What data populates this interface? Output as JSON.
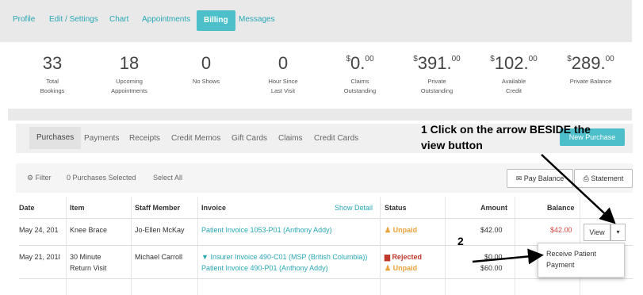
{
  "top_tabs": [
    "Profile",
    "Edit / Settings",
    "Chart",
    "Appointments",
    "Billing",
    "Messages"
  ],
  "active_tab": "Billing",
  "stats": [
    {
      "value": "33",
      "cents": "",
      "label_lines": [
        "Total",
        "Bookings"
      ]
    },
    {
      "value": "18",
      "cents": "",
      "label_lines": [
        "Upcoming",
        "Appointments"
      ]
    },
    {
      "value": "0",
      "cents": "",
      "label_lines": [
        "No Shows",
        ""
      ]
    },
    {
      "value": "0",
      "cents": "",
      "label_lines": [
        "Hour Since",
        "Last Visit"
      ]
    },
    {
      "currency": "$",
      "value": "0.",
      "cents": "00",
      "label_lines": [
        "Claims",
        "Outstanding"
      ]
    },
    {
      "currency": "$",
      "value": "391.",
      "cents": "00",
      "label_lines": [
        "Private",
        "Outstanding"
      ]
    },
    {
      "currency": "$",
      "value": "102.",
      "cents": "00",
      "label_lines": [
        "Available",
        "Credit"
      ]
    },
    {
      "currency": "$",
      "value": "289.",
      "cents": "00",
      "label_lines": [
        "Private Balance",
        ""
      ]
    }
  ],
  "sub_tabs": [
    "Purchases",
    "Payments",
    "Receipts",
    "Credit Memos",
    "Gift Cards",
    "Claims",
    "Credit Cards"
  ],
  "active_sub_tab": "Purchases",
  "new_purchase_label": "New Purchase",
  "filter_label": "Filter",
  "selected_count_label": "0 Purchases Selected",
  "select_all_label": "Select All",
  "pay_balance_label": "Pay Balance",
  "statement_label": "Statement",
  "table": {
    "headers": [
      "Date",
      "Item",
      "Staff Member",
      "Invoice",
      "Show Detail",
      "Status",
      "Amount",
      "Balance"
    ],
    "rows": [
      {
        "date": "May 24, 201",
        "item": [
          "Knee Brace"
        ],
        "staff": "Jo-Ellen McKay",
        "invoices": [
          "Patient Invoice 1053-P01 (Anthony Addy)"
        ],
        "statuses": [
          "Unpaid"
        ],
        "amounts": [
          "$42.00"
        ],
        "balance": "$42.00"
      },
      {
        "date": "May 21, 201I",
        "item": [
          "30 Minute",
          "Return Visit"
        ],
        "staff": "Michael Carroll",
        "invoices": [
          "Insurer Invoice 490-C01 (MSP (British Columbia))",
          "Patient Invoice 490-P01 (Anthony Addy)"
        ],
        "statuses": [
          "Rejected",
          "Unpaid"
        ],
        "amounts": [
          "$0.00",
          "$60.00"
        ],
        "balance": ""
      }
    ]
  },
  "view_label": "View",
  "dropdown_item": [
    "Receive Patient",
    "Payment"
  ],
  "annotations": {
    "step1": [
      "1 Click on the arrow BESIDE the",
      "view button"
    ],
    "step2": "2"
  }
}
